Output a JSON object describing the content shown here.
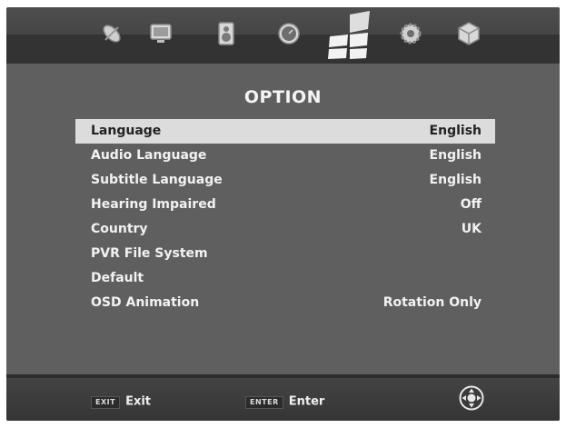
{
  "topbar": {
    "icons": [
      "satellite-icon",
      "tv-icon",
      "speaker-icon",
      "clock-icon",
      "option-icon",
      "settings-gear-icon",
      "cube-icon"
    ],
    "active_icon": "option-icon"
  },
  "menu": {
    "title": "OPTION",
    "items": [
      {
        "label": "Language",
        "value": "English"
      },
      {
        "label": "Audio Language",
        "value": "English"
      },
      {
        "label": "Subtitle Language",
        "value": "English"
      },
      {
        "label": "Hearing Impaired",
        "value": "Off"
      },
      {
        "label": "Country",
        "value": "UK"
      },
      {
        "label": "PVR File System",
        "value": ""
      },
      {
        "label": "Default",
        "value": ""
      },
      {
        "label": "OSD Animation",
        "value": "Rotation Only"
      }
    ],
    "selected_index": 0
  },
  "footer": {
    "exit_key": "EXIT",
    "exit_label": "Exit",
    "enter_key": "ENTER",
    "enter_label": "Enter",
    "nav_icon": "navigation-pad-icon"
  },
  "colors": {
    "background": "#5f5f5f",
    "selected_row": "#dcdcdc",
    "text": "#f2f2f2"
  }
}
